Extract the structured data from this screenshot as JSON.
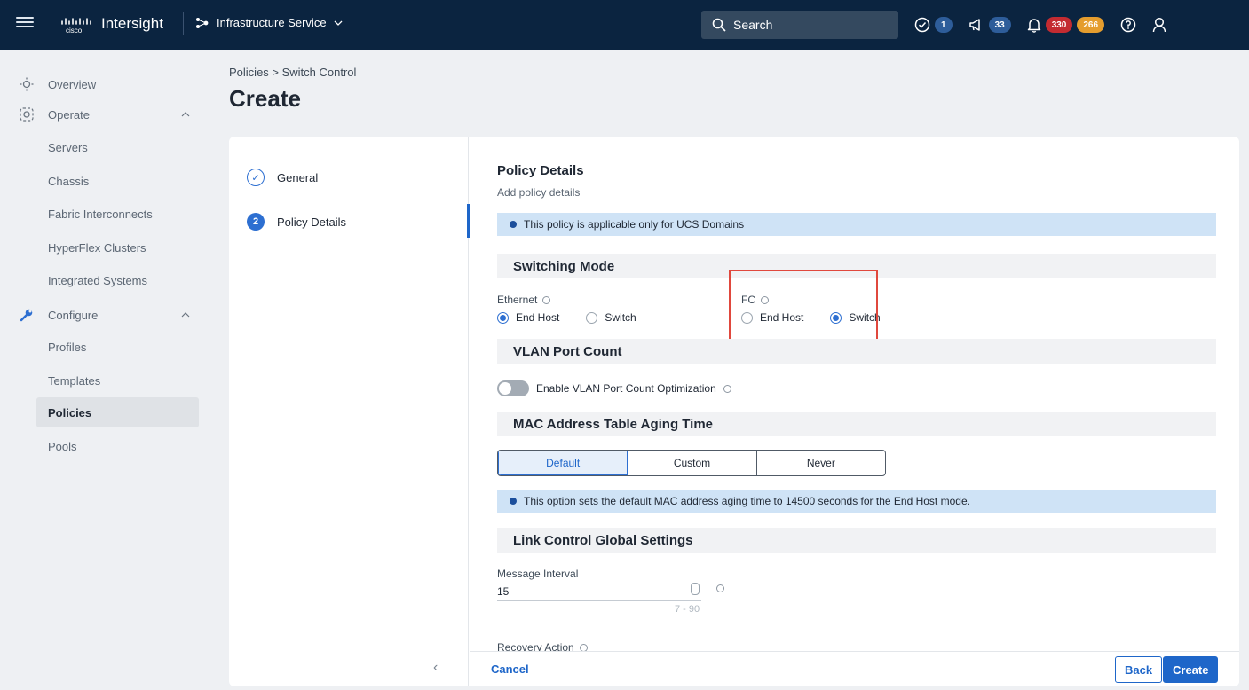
{
  "topbar": {
    "brand_logo": "cisco",
    "app_name": "Intersight",
    "service_name": "Infrastructure Service",
    "search_label": "Search",
    "status_count": "1",
    "announcements_count": "33",
    "alarms_critical": "330",
    "alarms_warning": "266"
  },
  "sidebar": {
    "overview": "Overview",
    "operate": "Operate",
    "operate_items": [
      "Servers",
      "Chassis",
      "Fabric Interconnects",
      "HyperFlex Clusters",
      "Integrated Systems"
    ],
    "configure": "Configure",
    "configure_items": [
      "Profiles",
      "Templates",
      "Policies",
      "Pools"
    ]
  },
  "header": {
    "breadcrumb": "Policies  >  Switch Control",
    "title": "Create"
  },
  "steps": [
    {
      "number": "1",
      "label": "General",
      "state": "done"
    },
    {
      "number": "2",
      "label": "Policy Details",
      "state": "current"
    }
  ],
  "form": {
    "title": "Policy Details",
    "subtitle": "Add policy details",
    "domain_note": "This policy is applicable only for UCS Domains",
    "switching_mode": {
      "heading": "Switching Mode",
      "ethernet_label": "Ethernet",
      "fc_label": "FC",
      "option_end_host": "End Host",
      "option_switch": "Switch",
      "ethernet_value": "End Host",
      "fc_value": "Switch"
    },
    "vlan": {
      "heading": "VLAN Port Count",
      "toggle_label": "Enable VLAN Port Count Optimization",
      "enabled": false
    },
    "mac_aging": {
      "heading": "MAC Address Table Aging Time",
      "options": [
        "Default",
        "Custom",
        "Never"
      ],
      "selected": "Default",
      "note": "This option sets the default MAC address aging time to 14500 seconds for the End Host mode."
    },
    "link_control": {
      "heading": "Link Control Global Settings",
      "message_interval_label": "Message Interval",
      "message_interval_value": "15",
      "message_interval_range": "7 - 90",
      "recovery_action_label": "Recovery Action"
    }
  },
  "footer": {
    "cancel": "Cancel",
    "back": "Back",
    "create": "Create"
  },
  "colors": {
    "topbar_bg": "#0b2440",
    "accent": "#1e66c9",
    "highlight": "#e0483d"
  }
}
